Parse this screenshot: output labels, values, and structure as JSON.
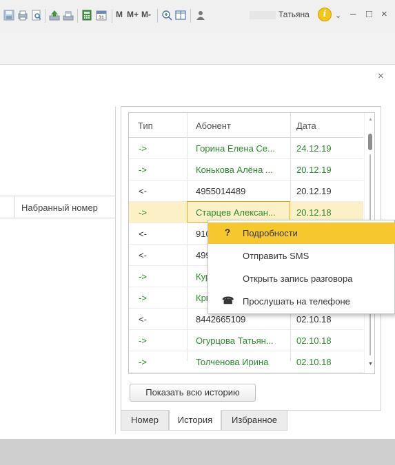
{
  "toolbar": {
    "buttons": [
      "save-icon",
      "print-icon",
      "print-preview-icon",
      "upload-icon",
      "download-icon",
      "calculator-icon",
      "calendar-icon"
    ],
    "memory": [
      "M",
      "M+",
      "M-"
    ],
    "user_name": "Татьяна",
    "info": "i"
  },
  "window": {
    "minimize": "–",
    "maximize": "□",
    "close": "×",
    "panel_close": "×"
  },
  "left_list": {
    "column_header": "Набранный номер"
  },
  "grid": {
    "columns": [
      "Тип",
      "Абонент",
      "Дата"
    ],
    "rows": [
      {
        "type": "->",
        "subscriber": "Горина Елена Се...",
        "date": "24.12.19"
      },
      {
        "type": "->",
        "subscriber": "Конькова Алёна ...",
        "date": "20.12.19"
      },
      {
        "type": "<-",
        "subscriber": "4955014489",
        "date": "20.12.19"
      },
      {
        "type": "->",
        "subscriber": "Старцев Алексан...",
        "date": "20.12.18"
      },
      {
        "type": "<-",
        "subscriber": "910",
        "date": ""
      },
      {
        "type": "<-",
        "subscriber": "499",
        "date": ""
      },
      {
        "type": "->",
        "subscriber": "Кур",
        "date": ""
      },
      {
        "type": "->",
        "subscriber": "Крн",
        "date": ""
      },
      {
        "type": "<-",
        "subscriber": "8442665109",
        "date": "02.10.18"
      },
      {
        "type": "->",
        "subscriber": "Огурцова Татьян...",
        "date": "02.10.18"
      },
      {
        "type": "->",
        "subscriber": "Толченова Ирина",
        "date": "02.10.18"
      }
    ]
  },
  "show_history_button": "Показать всю историю",
  "tabs": [
    "Номер",
    "История",
    "Избранное"
  ],
  "context_menu": {
    "items": [
      {
        "label": "Подробности",
        "icon": "?"
      },
      {
        "label": "Отправить SMS",
        "icon": ""
      },
      {
        "label": "Открыть запись разговора",
        "icon": ""
      },
      {
        "label": "Прослушать на телефоне",
        "icon": "☎"
      }
    ]
  },
  "colors": {
    "accent": "#f6c82e",
    "incoming_text": "#2a8a2a",
    "selection": "#fbf0c6"
  }
}
